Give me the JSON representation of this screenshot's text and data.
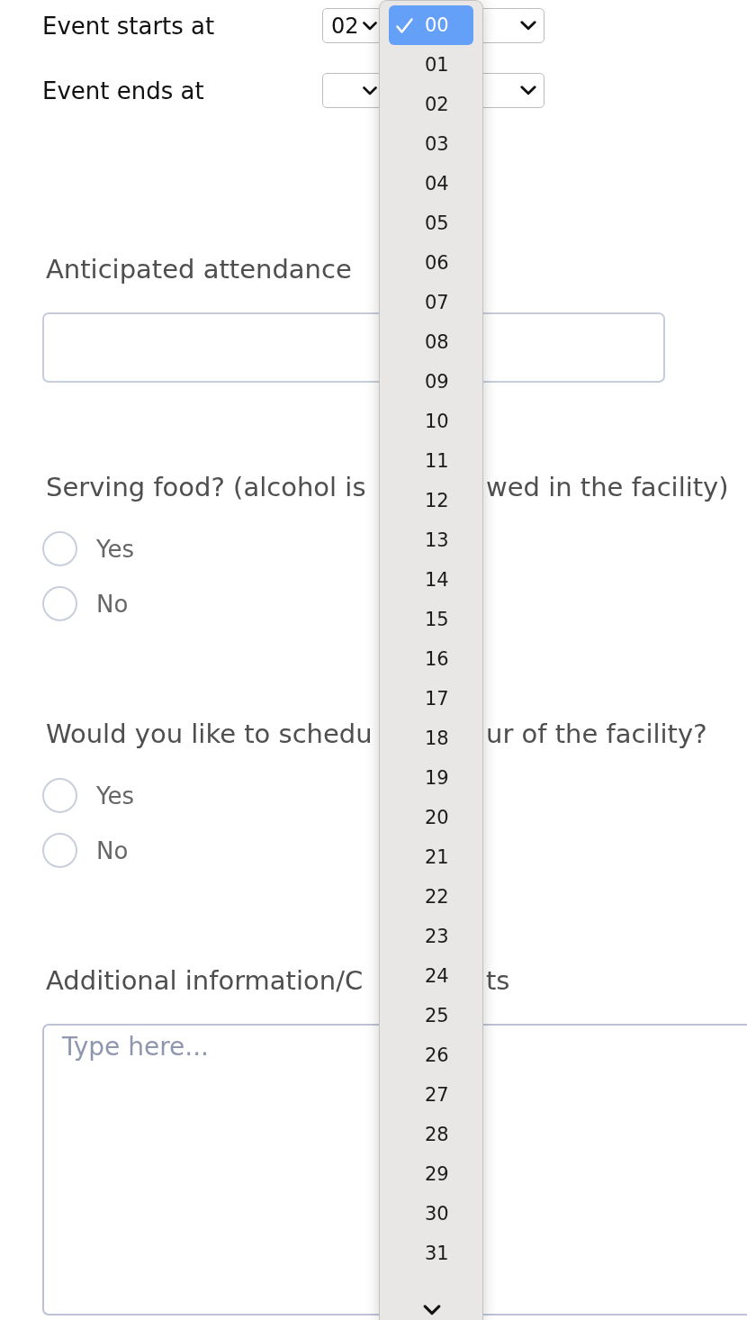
{
  "time_rows": [
    {
      "label": "Event starts at",
      "hour_value": "02",
      "minute_menu": {
        "options": [
          {
            "label": "00",
            "selected": true
          },
          {
            "label": "01",
            "selected": false
          },
          {
            "label": "02",
            "selected": false
          },
          {
            "label": "03",
            "selected": false
          },
          {
            "label": "04",
            "selected": false
          },
          {
            "label": "05",
            "selected": false
          },
          {
            "label": "06",
            "selected": false
          },
          {
            "label": "07",
            "selected": false
          },
          {
            "label": "08",
            "selected": false
          },
          {
            "label": "09",
            "selected": false
          },
          {
            "label": "10",
            "selected": false
          },
          {
            "label": "11",
            "selected": false
          },
          {
            "label": "12",
            "selected": false
          },
          {
            "label": "13",
            "selected": false
          },
          {
            "label": "14",
            "selected": false
          },
          {
            "label": "15",
            "selected": false
          },
          {
            "label": "16",
            "selected": false
          },
          {
            "label": "17",
            "selected": false
          },
          {
            "label": "18",
            "selected": false
          },
          {
            "label": "19",
            "selected": false
          },
          {
            "label": "20",
            "selected": false
          },
          {
            "label": "21",
            "selected": false
          },
          {
            "label": "22",
            "selected": false
          },
          {
            "label": "23",
            "selected": false
          },
          {
            "label": "24",
            "selected": false
          },
          {
            "label": "25",
            "selected": false
          },
          {
            "label": "26",
            "selected": false
          },
          {
            "label": "27",
            "selected": false
          },
          {
            "label": "28",
            "selected": false
          },
          {
            "label": "29",
            "selected": false
          },
          {
            "label": "30",
            "selected": false
          },
          {
            "label": "31",
            "selected": false
          }
        ]
      }
    },
    {
      "label": "Event ends at"
    }
  ],
  "attendance": {
    "label": "Anticipated attendance"
  },
  "questions": [
    {
      "label_start": "Serving food? (alcohol is",
      "label_end": "wed in the facility)",
      "options": [
        {
          "label": "Yes",
          "selected": false
        },
        {
          "label": "No",
          "selected": false
        }
      ]
    },
    {
      "label_start": "Would you like to schedu",
      "label_end": "ur of the facility?",
      "options": [
        {
          "label": "Yes",
          "selected": false
        },
        {
          "label": "No",
          "selected": false
        }
      ]
    }
  ],
  "comments": {
    "label_start": "Additional information/C",
    "label_end": "ts",
    "placeholder": "Type here..."
  }
}
